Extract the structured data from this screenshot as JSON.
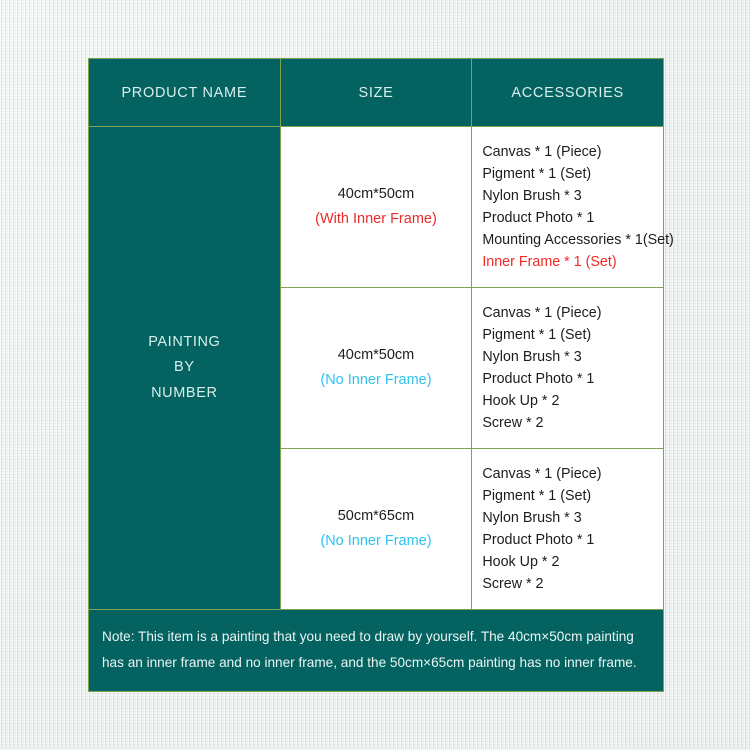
{
  "theme": {
    "teal": "#046260",
    "border_green": "#7ea24f",
    "header_text": "#d8efec",
    "red": "#ed2b28",
    "cyan": "#2ec3ef",
    "body_text": "#1d1d1d",
    "page_background": "#e6eceb"
  },
  "table": {
    "headers": [
      {
        "label": "PRODUCT NAME"
      },
      {
        "label": "SIZE"
      },
      {
        "label": "ACCESSORIES"
      }
    ],
    "product_name": {
      "lines": [
        "PAINTING",
        "BY",
        "NUMBER"
      ]
    },
    "rows": [
      {
        "size": {
          "dimensions": "40cm*50cm",
          "frame_note": "(With Inner Frame)",
          "frame_note_color": "red"
        },
        "accessories": [
          {
            "text": "Canvas * 1 (Piece)",
            "color": "default"
          },
          {
            "text": "Pigment * 1 (Set)",
            "color": "default"
          },
          {
            "text": "Nylon Brush * 3",
            "color": "default"
          },
          {
            "text": "Product Photo * 1",
            "color": "default"
          },
          {
            "text": "Mounting Accessories * 1(Set)",
            "color": "default"
          },
          {
            "text": "Inner Frame * 1 (Set)",
            "color": "red"
          }
        ]
      },
      {
        "size": {
          "dimensions": "40cm*50cm",
          "frame_note": "(No Inner Frame)",
          "frame_note_color": "cyan"
        },
        "accessories": [
          {
            "text": "Canvas * 1 (Piece)",
            "color": "default"
          },
          {
            "text": "Pigment * 1 (Set)",
            "color": "default"
          },
          {
            "text": "Nylon Brush * 3",
            "color": "default"
          },
          {
            "text": "Product Photo * 1",
            "color": "default"
          },
          {
            "text": "Hook Up * 2",
            "color": "default"
          },
          {
            "text": "Screw * 2",
            "color": "default"
          }
        ]
      },
      {
        "size": {
          "dimensions": "50cm*65cm",
          "frame_note": "(No Inner Frame)",
          "frame_note_color": "cyan"
        },
        "accessories": [
          {
            "text": "Canvas * 1 (Piece)",
            "color": "default"
          },
          {
            "text": "Pigment * 1 (Set)",
            "color": "default"
          },
          {
            "text": "Nylon Brush * 3",
            "color": "default"
          },
          {
            "text": "Product Photo * 1",
            "color": "default"
          },
          {
            "text": "Hook Up * 2",
            "color": "default"
          },
          {
            "text": "Screw * 2",
            "color": "default"
          }
        ]
      }
    ],
    "note": "Note: This item is a painting that you need to draw by yourself. The 40cm×50cm painting has an inner frame and no inner frame, and the 50cm×65cm painting has no inner frame."
  }
}
